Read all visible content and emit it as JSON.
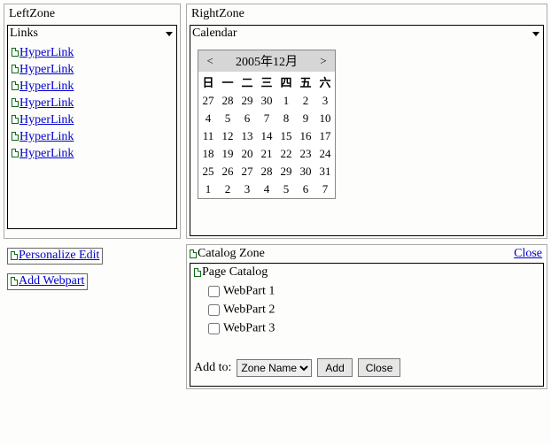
{
  "leftZone": {
    "title": "LeftZone",
    "linksPart": {
      "title": "Links",
      "items": [
        {
          "label": "HyperLink"
        },
        {
          "label": "HyperLink"
        },
        {
          "label": "HyperLink"
        },
        {
          "label": "HyperLink"
        },
        {
          "label": "HyperLink"
        },
        {
          "label": "HyperLink"
        },
        {
          "label": "HyperLink"
        }
      ]
    }
  },
  "rightZone": {
    "title": "RightZone",
    "calendarPart": {
      "title": "Calendar",
      "header": "2005年12月",
      "prev": "<",
      "next": ">",
      "weekdays": [
        "日",
        "一",
        "二",
        "三",
        "四",
        "五",
        "六"
      ],
      "weeks": [
        [
          "27",
          "28",
          "29",
          "30",
          "1",
          "2",
          "3"
        ],
        [
          "4",
          "5",
          "6",
          "7",
          "8",
          "9",
          "10"
        ],
        [
          "11",
          "12",
          "13",
          "14",
          "15",
          "16",
          "17"
        ],
        [
          "18",
          "19",
          "20",
          "21",
          "22",
          "23",
          "24"
        ],
        [
          "25",
          "26",
          "27",
          "28",
          "29",
          "30",
          "31"
        ],
        [
          "1",
          "2",
          "3",
          "4",
          "5",
          "6",
          "7"
        ]
      ]
    }
  },
  "actions": {
    "personalize": "Personalize Edit",
    "addWebpart": "Add Webpart"
  },
  "catalog": {
    "zoneTitle": "Catalog Zone",
    "close": "Close",
    "subtitle": "Page Catalog",
    "items": [
      {
        "label": "WebPart 1"
      },
      {
        "label": "WebPart 2"
      },
      {
        "label": "WebPart 3"
      }
    ],
    "addToLabel": "Add to:",
    "selectValue": "Zone Name",
    "addButton": "Add",
    "closeButton": "Close"
  }
}
